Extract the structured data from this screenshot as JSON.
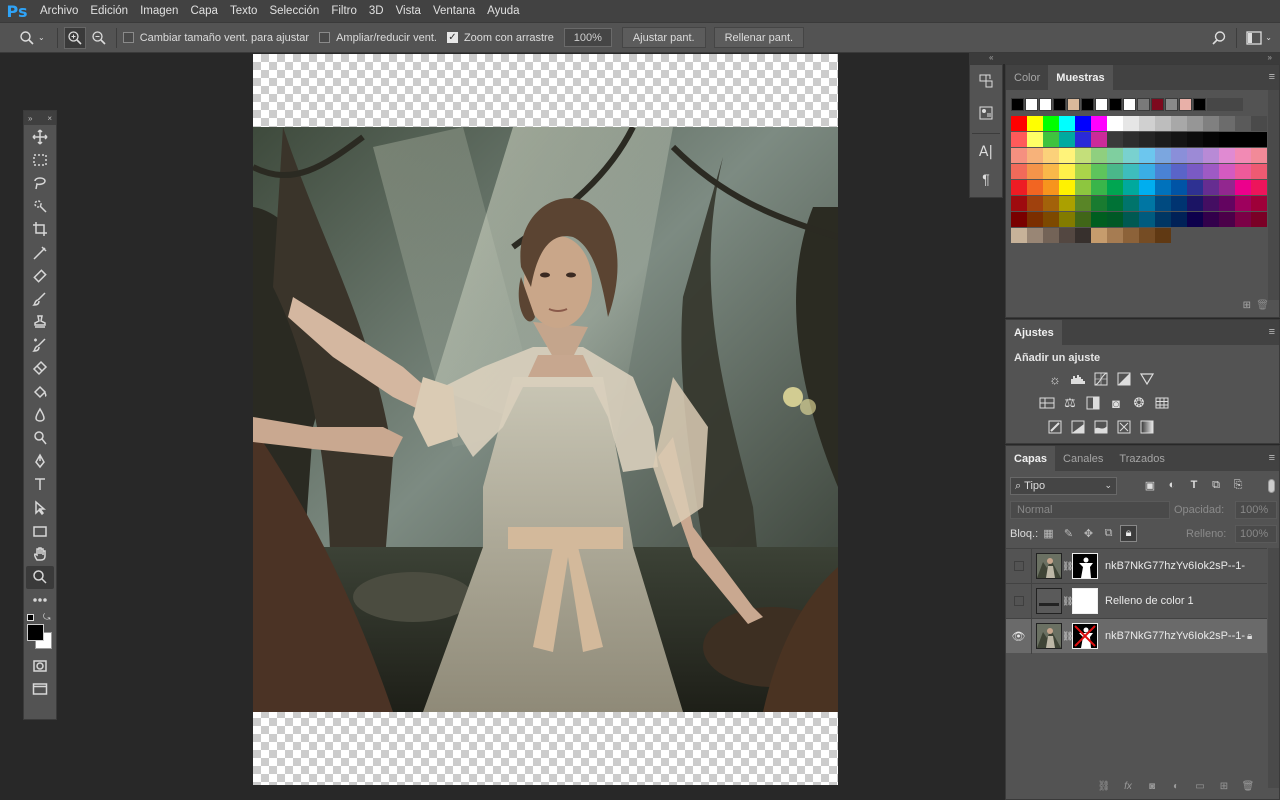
{
  "app": {
    "logo": "Ps"
  },
  "menu": [
    "Archivo",
    "Edición",
    "Imagen",
    "Capa",
    "Texto",
    "Selección",
    "Filtro",
    "3D",
    "Vista",
    "Ventana",
    "Ayuda"
  ],
  "options": {
    "resize_windows": "Cambiar tamaño vent. para ajustar",
    "resize_windows_checked": false,
    "zoom_all": "Ampliar/reducir vent.",
    "zoom_all_checked": false,
    "scrubby_zoom": "Zoom con arrastre",
    "scrubby_zoom_checked": true,
    "zoom_value": "100%",
    "fit_screen": "Ajustar pant.",
    "fill_screen": "Rellenar pant."
  },
  "tools": [
    "move-tool",
    "marquee-tool",
    "lasso-tool",
    "quick-select-tool",
    "crop-tool",
    "eyedropper-tool",
    "healing-tool",
    "brush-tool",
    "stamp-tool",
    "history-brush-tool",
    "eraser-tool",
    "paint-bucket-tool",
    "blur-tool",
    "dodge-tool",
    "pen-tool",
    "type-tool",
    "path-select-tool",
    "rectangle-tool",
    "hand-tool",
    "zoom-tool",
    "more-tools"
  ],
  "swatches_panel": {
    "tab_color": "Color",
    "tab_swatches": "Muestras",
    "recent": [
      "#000000",
      "#ffffff",
      "#ffffff",
      "#000000",
      "#d9b99b",
      "#000000",
      "#ffffff",
      "#000000",
      "#ffffff",
      "#7a7a7a",
      "#7d0a1e",
      "#8a8a8a",
      "#e8b0a8",
      "#000000"
    ],
    "rows": [
      [
        "#ff0000",
        "#ffff00",
        "#00ff00",
        "#00ffff",
        "#0000ff",
        "#ff00ff",
        "#ffffff",
        "#e6e6e6",
        "#d0d0d0",
        "#bdbdbd",
        "#a8a8a8",
        "#969696",
        "#808080",
        "#6c6c6c",
        "#5a5a5a",
        "#4a4a4a"
      ],
      [
        "#ff5a5a",
        "#ffff66",
        "#3fc33f",
        "#00aaa0",
        "#2a2ad8",
        "#cc2a9a",
        "#3a3a3a",
        "#2e2e2e",
        "#252525",
        "#1c1c1c",
        "#141414",
        "#0c0c0c",
        "#050505",
        "#000000",
        "#000000",
        "#000000"
      ],
      [
        "#f59080",
        "#f7b27a",
        "#fbd17a",
        "#fff37a",
        "#c4df7a",
        "#8fcf7f",
        "#7fcf9f",
        "#79d1cf",
        "#6cc6ee",
        "#7ba6df",
        "#8a8fd9",
        "#9c8ad6",
        "#b88ad6",
        "#e08ad2",
        "#f28ab4",
        "#f28a98"
      ],
      [
        "#f26a5a",
        "#f4944a",
        "#f9b84a",
        "#fff04a",
        "#aad44a",
        "#5ec45c",
        "#4ab88a",
        "#3ebdbd",
        "#3aaee5",
        "#4a82d4",
        "#5a64c8",
        "#7a5ac4",
        "#9e5ac4",
        "#d45ac0",
        "#ee5a9a",
        "#ee5a72"
      ],
      [
        "#ed1c24",
        "#f26522",
        "#f7941d",
        "#fff200",
        "#8dc63f",
        "#39b54a",
        "#00a651",
        "#00a99d",
        "#00aeef",
        "#0072bc",
        "#0054a6",
        "#2e3192",
        "#662d91",
        "#92278f",
        "#ec008c",
        "#ed145b"
      ],
      [
        "#9e0b0f",
        "#a0410d",
        "#a3620a",
        "#aba000",
        "#598527",
        "#197b30",
        "#007236",
        "#00746b",
        "#0076a3",
        "#004a80",
        "#003471",
        "#1b1464",
        "#440e62",
        "#630460",
        "#9e005d",
        "#9e0039"
      ],
      [
        "#790000",
        "#7b2e00",
        "#7d4900",
        "#827b00",
        "#406618",
        "#005e20",
        "#005826",
        "#005952",
        "#005b7f",
        "#003663",
        "#002157",
        "#0d004c",
        "#32004b",
        "#4b0049",
        "#7b0046",
        "#7a0026"
      ],
      [
        "#c7b299",
        "#998675",
        "#736357",
        "#534741",
        "#37302d",
        "#c69c6d",
        "#a67c52",
        "#8c6239",
        "#754c24",
        "#603913"
      ]
    ]
  },
  "adjustments_panel": {
    "tab": "Ajustes",
    "heading": "Añadir un ajuste",
    "row1": [
      "brightness-icon",
      "levels-icon",
      "curves-icon",
      "exposure-icon",
      "gradient-triangle-icon"
    ],
    "row2": [
      "vibrance-icon",
      "balance-icon",
      "bw-icon",
      "photo-filter-icon",
      "channel-mixer-icon",
      "lookup-icon"
    ],
    "row3": [
      "invert-icon",
      "posterize-icon",
      "threshold-icon",
      "selective-color-icon",
      "gradient-map-icon"
    ]
  },
  "layers_panel": {
    "tabs": [
      "Capas",
      "Canales",
      "Trazados"
    ],
    "filter": "Tipo",
    "blend_mode": "Normal",
    "opacity_label": "Opacidad:",
    "opacity_value": "100%",
    "lock_label": "Bloq.:",
    "fill_label": "Relleno:",
    "fill_value": "100%",
    "layers": [
      {
        "name": "nkB7NkG77hzYv6Iok2sP--1--on...",
        "visible": false,
        "selected": false,
        "locked": false
      },
      {
        "name": "Relleno de color 1",
        "visible": false,
        "selected": false,
        "locked": false
      },
      {
        "name": "nkB7NkG77hzYv6Iok2sP--1-...",
        "visible": true,
        "selected": true,
        "locked": true
      }
    ]
  }
}
